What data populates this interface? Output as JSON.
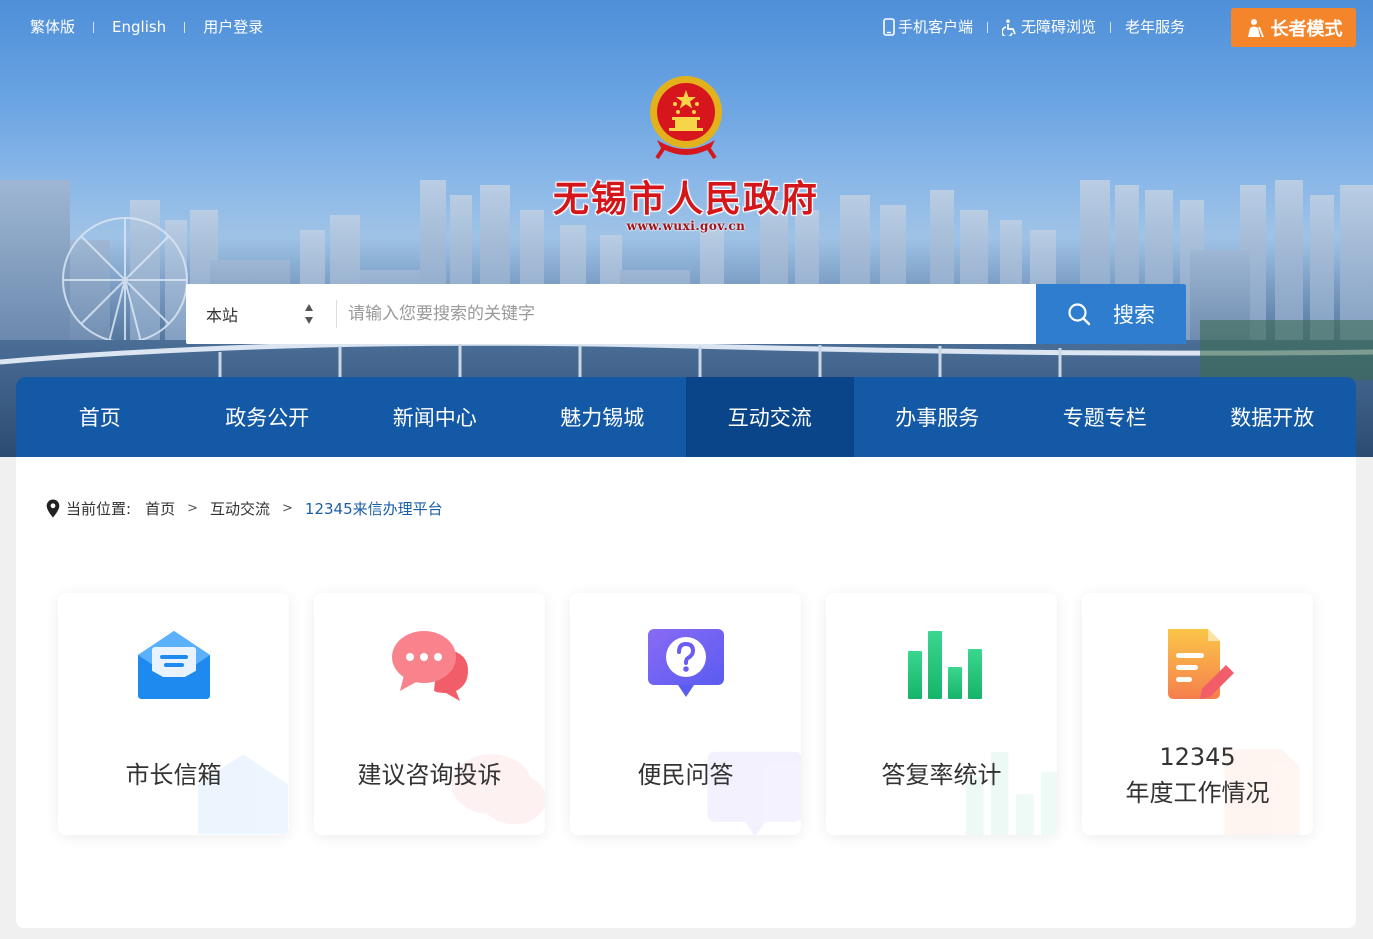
{
  "topbar": {
    "left_links": [
      "繁体版",
      "English",
      "用户登录"
    ],
    "mobile_label": "手机客户端",
    "accessibility_label": "无障碍浏览",
    "senior_service_label": "老年服务",
    "elder_mode_label": "长者模式"
  },
  "header": {
    "site_title": "无锡市人民政府",
    "site_url": "www.wuxi.gov.cn"
  },
  "search": {
    "scope_value": "本站",
    "placeholder": "请输入您要搜索的关键字",
    "button_label": "搜索"
  },
  "nav": {
    "items": [
      "首页",
      "政务公开",
      "新闻中心",
      "魅力锡城",
      "互动交流",
      "办事服务",
      "专题专栏",
      "数据开放"
    ],
    "active_index": 4
  },
  "breadcrumb": {
    "prefix": "当前位置:",
    "items": [
      "首页",
      "互动交流",
      "12345来信办理平台"
    ],
    "separator": ">"
  },
  "cards": [
    {
      "label": "市长信箱",
      "icon": "mail-icon",
      "color": "#1e8af0"
    },
    {
      "label": "建议咨询投诉",
      "icon": "chat-bubbles-icon",
      "color": "#f25d6a"
    },
    {
      "label": "便民问答",
      "icon": "question-icon",
      "color": "#6a5ef2"
    },
    {
      "label": "答复率统计",
      "icon": "bar-chart-icon",
      "color": "#23c27a"
    },
    {
      "label_line1": "12345",
      "label_line2": "年度工作情况",
      "icon": "document-edit-icon",
      "color": "#f5864f"
    }
  ],
  "colors": {
    "nav_bg": "#1459a6",
    "nav_active": "#0a4589",
    "search_btn": "#2e7dce",
    "elder_btn": "#f4852b",
    "title_red": "#d4161b",
    "crumb_current": "#1b5ea8"
  }
}
